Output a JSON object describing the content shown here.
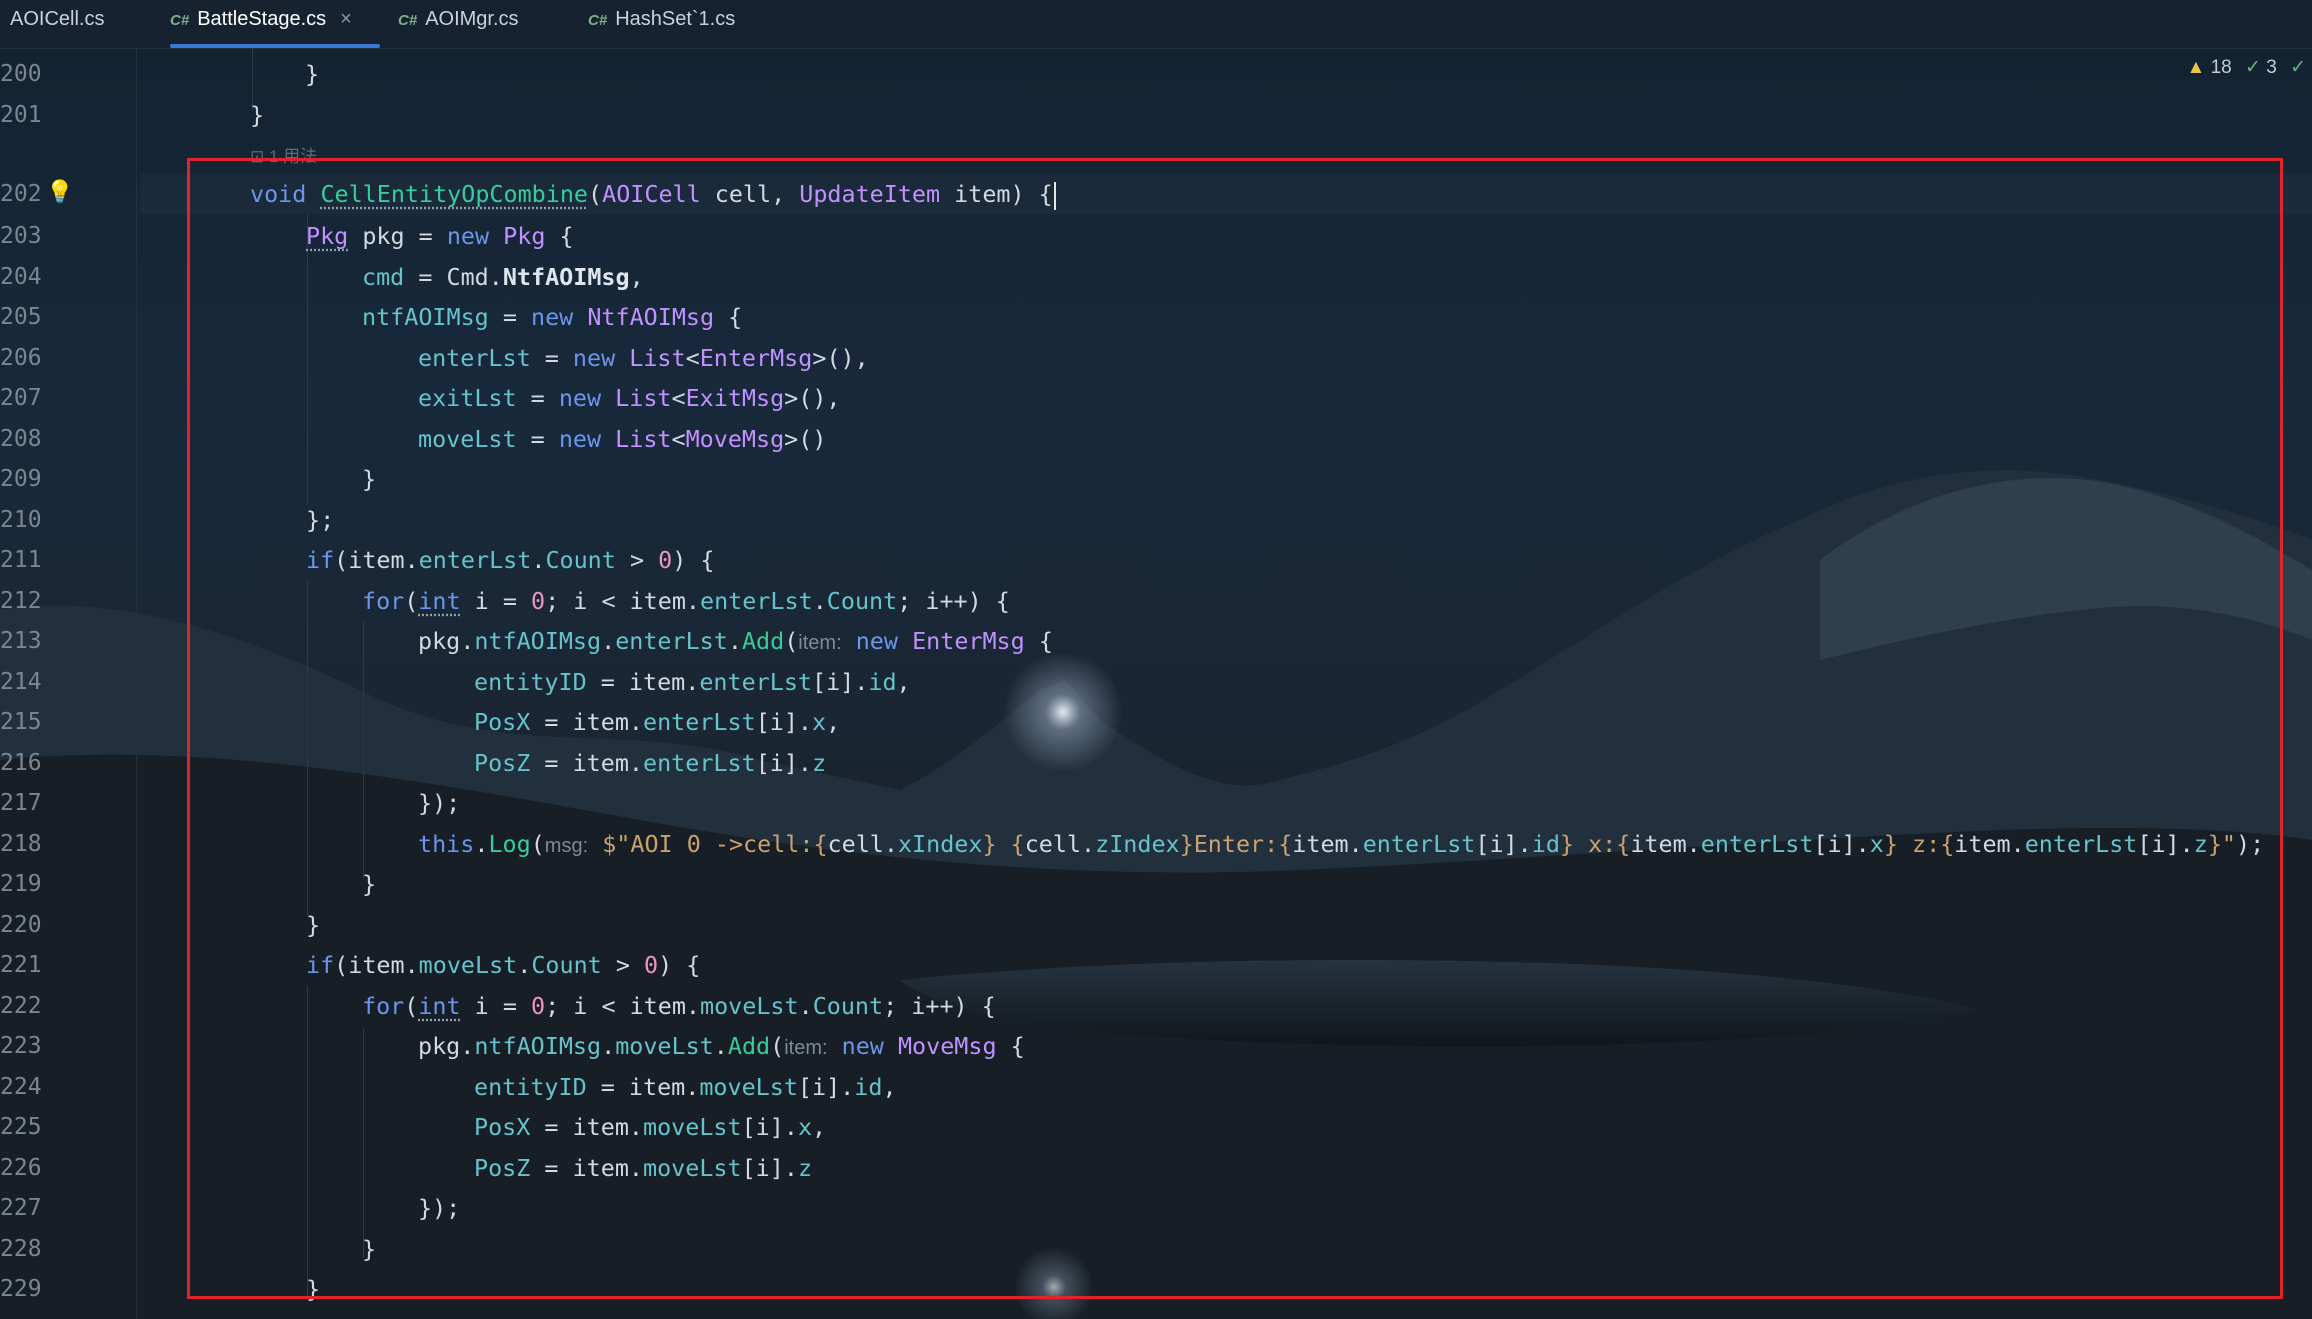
{
  "tabs": [
    {
      "icon_label": "",
      "label": "AOICell.cs",
      "active": false,
      "closable": false
    },
    {
      "icon_label": "C#",
      "label": "BattleStage.cs",
      "active": true,
      "closable": true
    },
    {
      "icon_label": "C#",
      "label": "AOIMgr.cs",
      "active": false,
      "closable": false
    },
    {
      "icon_label": "C#",
      "label": "HashSet`1.cs",
      "active": false,
      "closable": false
    }
  ],
  "inspections": {
    "warnings": "18",
    "ok": "3"
  },
  "usage_hint": "1 用法",
  "lines": [
    {
      "num": "200"
    },
    {
      "num": "201"
    },
    {
      "num": "202"
    },
    {
      "num": "203"
    },
    {
      "num": "204"
    },
    {
      "num": "205"
    },
    {
      "num": "206"
    },
    {
      "num": "207"
    },
    {
      "num": "208"
    },
    {
      "num": "209"
    },
    {
      "num": "210"
    },
    {
      "num": "211"
    },
    {
      "num": "212"
    },
    {
      "num": "213"
    },
    {
      "num": "214"
    },
    {
      "num": "215"
    },
    {
      "num": "216"
    },
    {
      "num": "217"
    },
    {
      "num": "218"
    },
    {
      "num": "219"
    },
    {
      "num": "220"
    },
    {
      "num": "221"
    },
    {
      "num": "222"
    },
    {
      "num": "223"
    },
    {
      "num": "224"
    },
    {
      "num": "225"
    },
    {
      "num": "226"
    },
    {
      "num": "227"
    },
    {
      "num": "228"
    },
    {
      "num": "229"
    }
  ],
  "code": {
    "l200": "}",
    "l201": "}",
    "l202_void": "void",
    "l202_fn": "CellEntityOpCombine",
    "l202_p1": "(",
    "l202_t1": "AOICell",
    "l202_a1": " cell, ",
    "l202_t2": "UpdateItem",
    "l202_a2": " item) {",
    "l203_t": "Pkg",
    "l203_a": " pkg = ",
    "l203_new": "new",
    "l203_t2": " Pkg",
    "l203_b": " {",
    "l204_f": "cmd",
    "l204_a": " = Cmd.",
    "l204_b": "NtfAOIMsg",
    "l204_c": ",",
    "l205_f": "ntfAOIMsg",
    "l205_a": " = ",
    "l205_new": "new",
    "l205_t": " NtfAOIMsg",
    "l205_b": " {",
    "l206_f": "enterLst",
    "l206_a": " = ",
    "l206_new": "new",
    "l206_t": " List",
    "l206_b": "<",
    "l206_t2": "EnterMsg",
    "l206_c": ">(),",
    "l207_f": "exitLst",
    "l207_a": " = ",
    "l207_new": "new",
    "l207_t": " List",
    "l207_b": "<",
    "l207_t2": "ExitMsg",
    "l207_c": ">(),",
    "l208_f": "moveLst",
    "l208_a": " = ",
    "l208_new": "new",
    "l208_t": " List",
    "l208_b": "<",
    "l208_t2": "MoveMsg",
    "l208_c": ">()",
    "l209": "}",
    "l210": "};",
    "l211_kw": "if",
    "l211_a": "(item.",
    "l211_f": "enterLst",
    "l211_b": ".",
    "l211_f2": "Count",
    "l211_c": " > ",
    "l211_n": "0",
    "l211_d": ") {",
    "l212_kw": "for",
    "l212_a": "(",
    "l212_int": "int",
    "l212_b": " i = ",
    "l212_n": "0",
    "l212_c": "; i < item.",
    "l212_f": "enterLst",
    "l212_d": ".",
    "l212_f2": "Count",
    "l212_e": "; i++) {",
    "l213_a": "pkg.",
    "l213_f": "ntfAOIMsg",
    "l213_b": ".",
    "l213_f2": "enterLst",
    "l213_c": ".",
    "l213_fn": "Add",
    "l213_d": "(",
    "l213_hint": "item:",
    "l213_new": " new",
    "l213_t": " EnterMsg",
    "l213_e": " {",
    "l214_f": "entityID",
    "l214_a": " = item.",
    "l214_f2": "enterLst",
    "l214_b": "[i].",
    "l214_f3": "id",
    "l214_c": ",",
    "l215_f": "PosX",
    "l215_a": " = item.",
    "l215_f2": "enterLst",
    "l215_b": "[i].",
    "l215_f3": "x",
    "l215_c": ",",
    "l216_f": "PosZ",
    "l216_a": " = item.",
    "l216_f2": "enterLst",
    "l216_b": "[i].",
    "l216_f3": "z",
    "l217": "});",
    "l218_kw": "this",
    "l218_a": ".",
    "l218_fn": "Log",
    "l218_b": "(",
    "l218_hint": "msg:",
    "l218_s1": " $\"AOI 0 ->cell:{",
    "l218_c1": "cell.",
    "l218_f1": "xIndex",
    "l218_s2": "} {",
    "l218_c2": "cell.",
    "l218_f2": "zIndex",
    "l218_s3": "}Enter:{",
    "l218_c3": "item.",
    "l218_f3": "enterLst",
    "l218_c4": "[i].",
    "l218_f4": "id",
    "l218_s4": "} x:{",
    "l218_c5": "item.",
    "l218_f5": "enterLst",
    "l218_c6": "[i].",
    "l218_f6": "x",
    "l218_s5": "} z:{",
    "l218_c7": "item.",
    "l218_f7": "enterLst",
    "l218_c8": "[i].",
    "l218_f8": "z",
    "l218_s6": "}\"",
    "l218_end": ");",
    "l219": "}",
    "l220": "}",
    "l221_kw": "if",
    "l221_a": "(item.",
    "l221_f": "moveLst",
    "l221_b": ".",
    "l221_f2": "Count",
    "l221_c": " > ",
    "l221_n": "0",
    "l221_d": ") {",
    "l222_kw": "for",
    "l222_a": "(",
    "l222_int": "int",
    "l222_b": " i = ",
    "l222_n": "0",
    "l222_c": "; i < item.",
    "l222_f": "moveLst",
    "l222_d": ".",
    "l222_f2": "Count",
    "l222_e": "; i++) {",
    "l223_a": "pkg.",
    "l223_f": "ntfAOIMsg",
    "l223_b": ".",
    "l223_f2": "moveLst",
    "l223_c": ".",
    "l223_fn": "Add",
    "l223_d": "(",
    "l223_hint": "item:",
    "l223_new": " new",
    "l223_t": " MoveMsg",
    "l223_e": " {",
    "l224_f": "entityID",
    "l224_a": " = item.",
    "l224_f2": "moveLst",
    "l224_b": "[i].",
    "l224_f3": "id",
    "l224_c": ",",
    "l225_f": "PosX",
    "l225_a": " = item.",
    "l225_f2": "moveLst",
    "l225_b": "[i].",
    "l225_f3": "x",
    "l225_c": ",",
    "l226_f": "PosZ",
    "l226_a": " = item.",
    "l226_f2": "moveLst",
    "l226_b": "[i].",
    "l226_f3": "z",
    "l227": "});",
    "l228": "}",
    "l229": "}"
  },
  "colors": {
    "keyword": "#6c95eb",
    "type": "#c191ff",
    "method": "#39cc9b",
    "field": "#66c3cc",
    "number": "#ed94c0",
    "string": "#c9a26d",
    "highlight_box": "#e0242c"
  }
}
